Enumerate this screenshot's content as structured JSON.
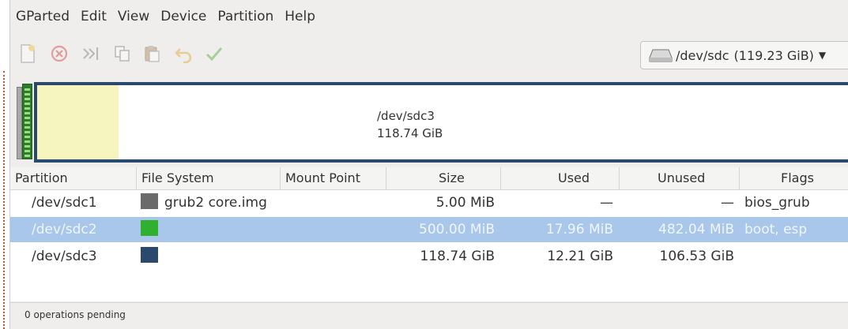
{
  "menu": [
    "GParted",
    "Edit",
    "View",
    "Device",
    "Partition",
    "Help"
  ],
  "toolbar": {
    "buttons": [
      {
        "name": "new-icon"
      },
      {
        "name": "delete-icon"
      },
      {
        "name": "resize-move-icon"
      },
      {
        "name": "copy-icon"
      },
      {
        "name": "paste-icon"
      },
      {
        "name": "undo-icon"
      },
      {
        "name": "apply-icon"
      }
    ],
    "device": "/dev/sdc",
    "device_size": "(119.23 GiB)"
  },
  "graphic": {
    "partition_name": "/dev/sdc3",
    "partition_size": "118.74 GiB"
  },
  "columns": [
    "Partition",
    "File System",
    "Mount Point",
    "Size",
    "Used",
    "Unused",
    "Flags"
  ],
  "rows": [
    {
      "partition": "/dev/sdc1",
      "fs_color": "#6b6b6b",
      "fs": "grub2 core.img",
      "mount": "",
      "size": "5.00 MiB",
      "used": "—",
      "unused": "—",
      "flags": "bios_grub",
      "selected": false
    },
    {
      "partition": "/dev/sdc2",
      "fs_color": "#2fb12f",
      "fs": "",
      "mount": "",
      "size": "500.00 MiB",
      "used": "17.96 MiB",
      "unused": "482.04 MiB",
      "flags": "boot, esp",
      "selected": true
    },
    {
      "partition": "/dev/sdc3",
      "fs_color": "#2a4a6d",
      "fs": "",
      "mount": "",
      "size": "118.74 GiB",
      "used": "12.21 GiB",
      "unused": "106.53 GiB",
      "flags": "",
      "selected": false
    }
  ],
  "status": "0 operations pending"
}
